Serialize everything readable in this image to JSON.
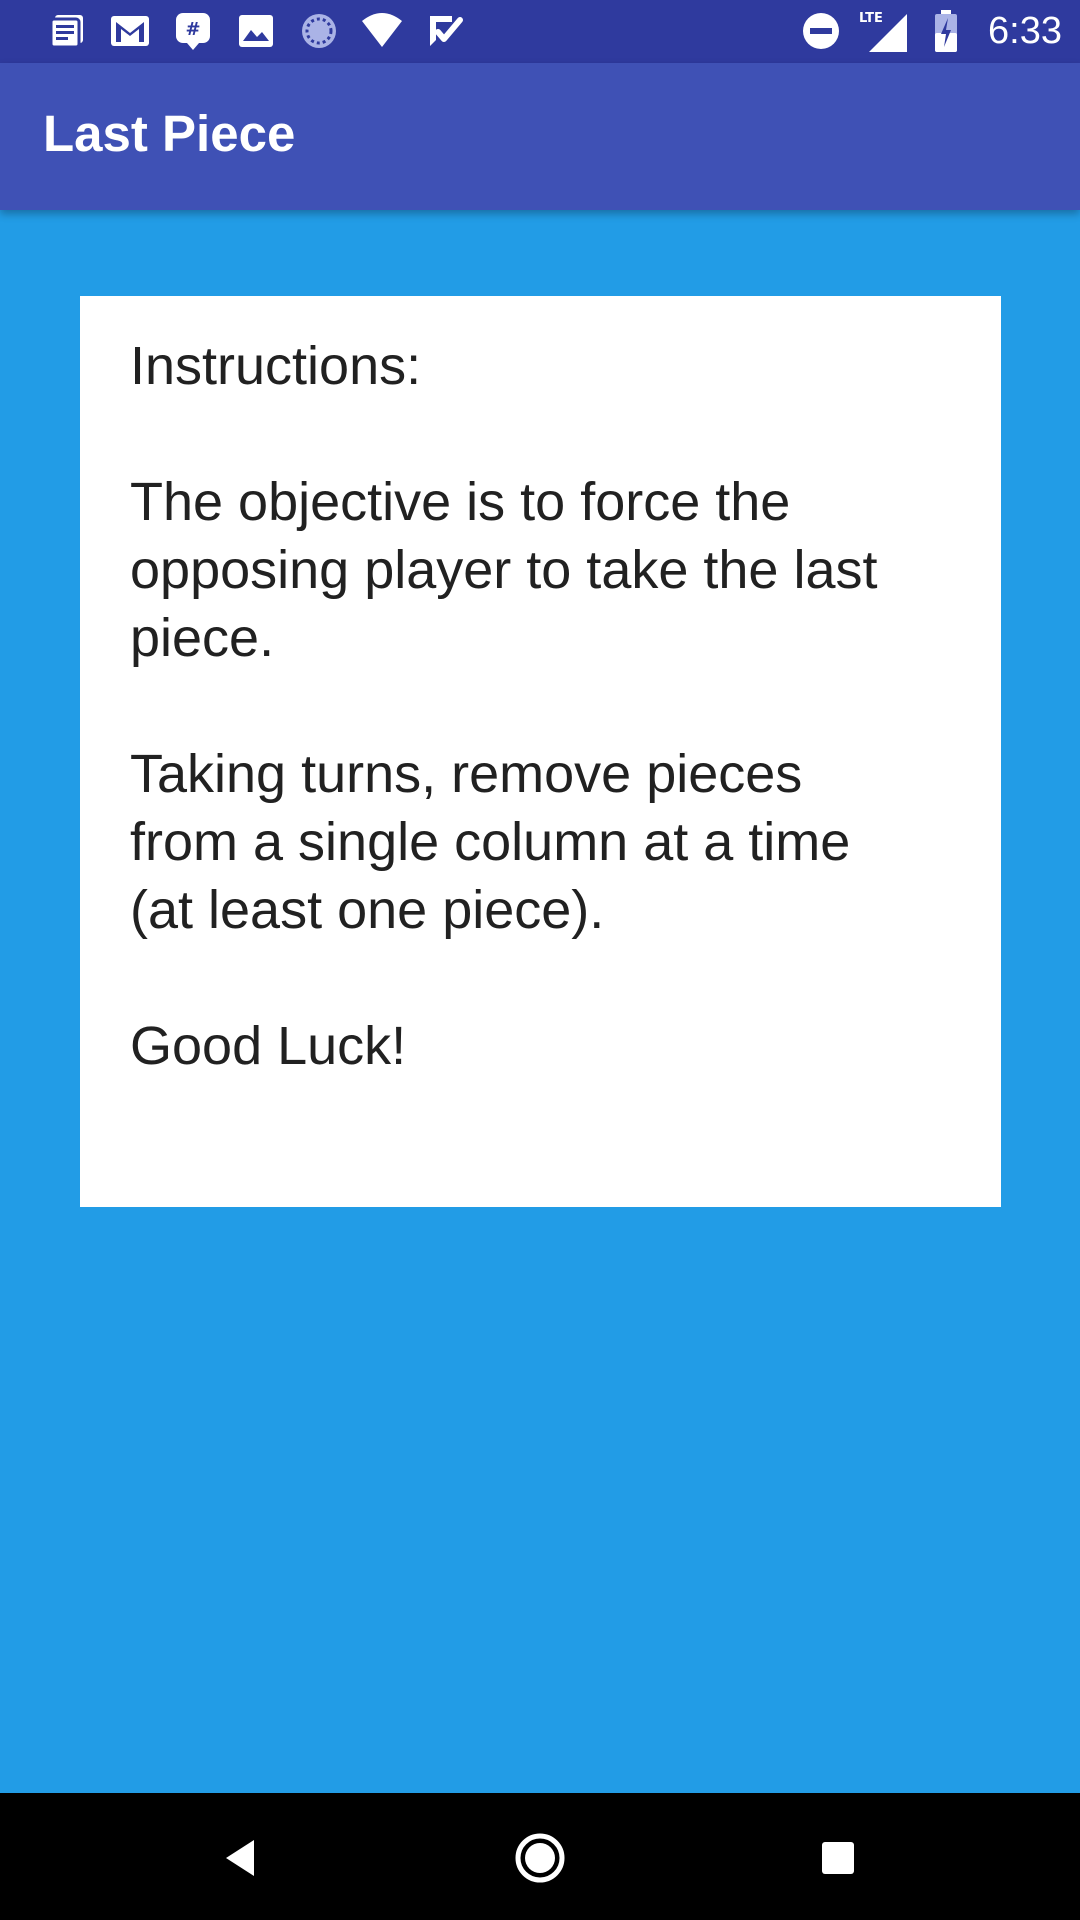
{
  "status_bar": {
    "time": "6:33",
    "network_label": "LTE",
    "left_icons": [
      "news-icon",
      "gmail-icon",
      "chat-icon",
      "image-icon",
      "sync-icon",
      "wifi-icon",
      "checklist-icon"
    ],
    "right_icons": [
      "do-not-disturb-icon",
      "signal-icon",
      "battery-charging-icon"
    ]
  },
  "app_bar": {
    "title": "Last Piece",
    "color": "#3f51b5"
  },
  "card": {
    "text": "Instructions:\n\nThe objective is to force the\nopposing player to take the last\npiece.\n\nTaking turns, remove pieces\nfrom a single column at a time\n(at least one piece).\n\nGood Luck!"
  },
  "nav_bar": {
    "buttons": [
      "back-icon",
      "home-icon",
      "recents-icon"
    ]
  },
  "colors": {
    "background": "#229ce6",
    "status_bar": "#2f3a9e",
    "card": "#ffffff",
    "text": "#212121"
  }
}
